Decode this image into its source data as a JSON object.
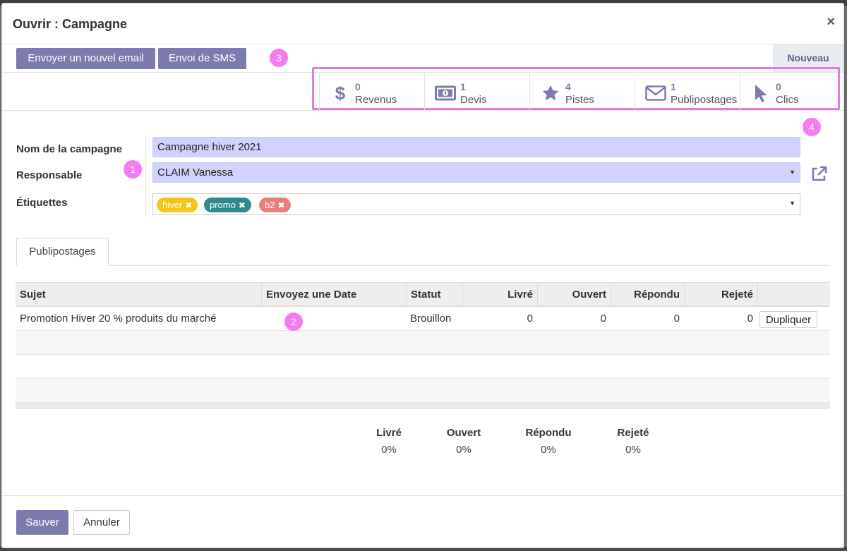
{
  "dialog": {
    "title": "Ouvrir : Campagne",
    "close_label": "×"
  },
  "header_buttons": {
    "send_email": "Envoyer un nouvel email",
    "send_sms": "Envoi de SMS",
    "stage": "Nouveau"
  },
  "annotations": [
    "1",
    "2",
    "3",
    "4"
  ],
  "smart_buttons": [
    {
      "value": "0",
      "label": "Revenus",
      "icon": "dollar-icon"
    },
    {
      "value": "1",
      "label": "Devis",
      "icon": "money-bill-icon"
    },
    {
      "value": "4",
      "label": "Pistes",
      "icon": "star-icon"
    },
    {
      "value": "1",
      "label": "Publipostages",
      "icon": "envelope-icon"
    },
    {
      "value": "0",
      "label": "Clics",
      "icon": "cursor-icon"
    }
  ],
  "form": {
    "campaign_name_label": "Nom de la campagne",
    "campaign_name_value": "Campagne hiver 2021",
    "responsible_label": "Responsable",
    "responsible_value": "CLAIM Vanessa",
    "tags_label": "Étiquettes",
    "tags": [
      {
        "label": "hiver",
        "color": "#f5c518"
      },
      {
        "label": "promo",
        "color": "#2e8b8b"
      },
      {
        "label": "b2",
        "color": "#e87e7e"
      }
    ]
  },
  "tabs": [
    {
      "label": "Publipostages"
    }
  ],
  "table": {
    "columns": [
      "Sujet",
      "Envoyez une Date",
      "Statut",
      "Livré",
      "Ouvert",
      "Répondu",
      "Rejeté"
    ],
    "rows": [
      {
        "subject": "Promotion Hiver 20 % produits du marché",
        "send_date": "",
        "status": "Brouillon",
        "delivered": "0",
        "opened": "0",
        "replied": "0",
        "rejected": "0",
        "action": "Dupliquer"
      }
    ]
  },
  "stats": [
    {
      "label": "Livré",
      "value": "0%"
    },
    {
      "label": "Ouvert",
      "value": "0%"
    },
    {
      "label": "Répondu",
      "value": "0%"
    },
    {
      "label": "Rejeté",
      "value": "0%"
    }
  ],
  "footer": {
    "save": "Sauver",
    "cancel": "Annuler"
  },
  "colors": {
    "primary": "#7c7bad",
    "annotation": "#f47cf0",
    "highlight_box": "#e07ae8",
    "required_field_bg": "#d2d2ff"
  }
}
